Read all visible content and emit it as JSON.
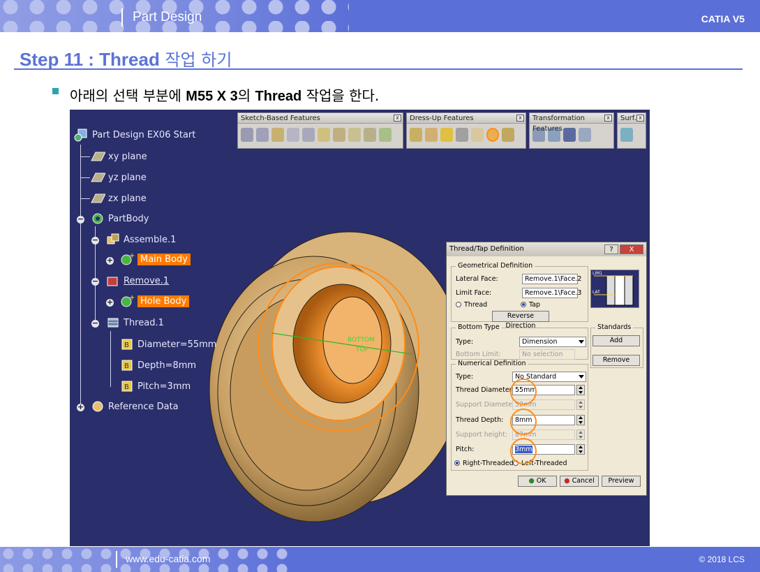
{
  "header": {
    "title": "Part Design",
    "brand": "CATIA V5"
  },
  "step": {
    "prefix": "Step 11 : Thread",
    "suffix": " 작업 하기"
  },
  "instruction": {
    "pre": "아래의 선택 부분에 ",
    "bold1": "M55 X 3",
    "mid": "의 ",
    "bold2": "Thread",
    "post": " 작업을 한다."
  },
  "tree": {
    "root": "Part Design EX06 Start",
    "planes": [
      "xy plane",
      "yz plane",
      "zx plane"
    ],
    "partbody": "PartBody",
    "assemble": "Assemble.1",
    "main_body": "Main Body",
    "remove": "Remove.1",
    "hole_body": "Hole Body",
    "thread": "Thread.1",
    "params": [
      "Diameter=55mm",
      "Depth=8mm",
      "Pitch=3mm"
    ],
    "reference": "Reference Data"
  },
  "toolbars": {
    "sketch": "Sketch-Based Features",
    "dressup": "Dress-Up Features",
    "transform": "Transformation Features",
    "surf": "Surf..."
  },
  "viewport_labels": {
    "bottom": "BOTTOM",
    "top": "TOP"
  },
  "dialog": {
    "title": "Thread/Tap Definition",
    "help": "?",
    "close": "X",
    "geo": {
      "legend": "Geometrical Definition",
      "lateral_label": "Lateral Face:",
      "lateral_value": "Remove.1\\Face.2",
      "limit_label": "Limit Face:",
      "limit_value": "Remove.1\\Face.3",
      "thread": "Thread",
      "tap": "Tap",
      "reverse": "Reverse Direction"
    },
    "bottom": {
      "legend": "Bottom Type",
      "type_label": "Type:",
      "type_value": "Dimension",
      "limit_label": "Bottom Limit:",
      "limit_value": "No selection"
    },
    "numerical": {
      "legend": "Numerical Definition",
      "type_label": "Type:",
      "type_value": "No Standard",
      "diameter_label": "Thread Diameter:",
      "diameter_value": "55mm",
      "support_diameter_label": "Support Diameter:",
      "support_diameter_value": "52mm",
      "depth_label": "Thread Depth:",
      "depth_value": "8mm",
      "support_height_label": "Support height:",
      "support_height_value": "87mm",
      "pitch_label": "Pitch:",
      "pitch_value": "3mm",
      "right": "Right-Threaded",
      "left": "Left-Threaded"
    },
    "standards": {
      "legend": "Standards",
      "add": "Add",
      "remove": "Remove"
    },
    "ok": "OK",
    "cancel": "Cancel",
    "preview": "Preview",
    "diagram_labels": {
      "lim1": "LIM1",
      "lat": "LAT"
    }
  },
  "footer": {
    "url": "www.edu-catia.com",
    "copyright": "© 2018 LCS"
  },
  "colors": {
    "header": "#5b6fd8",
    "step": "#5b72d6",
    "highlight": "#ff7a00",
    "viewport": "#2a2e6a"
  }
}
